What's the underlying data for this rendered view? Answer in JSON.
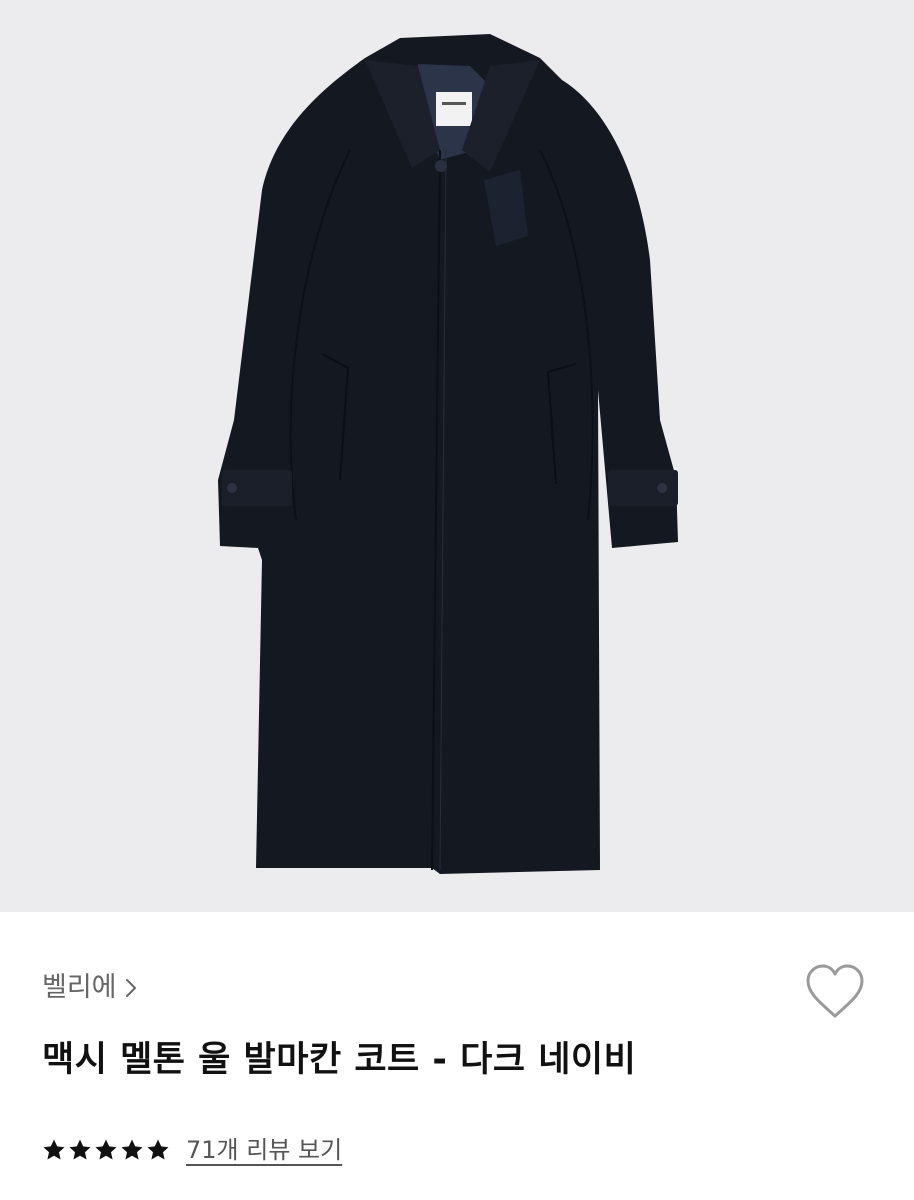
{
  "product": {
    "brand": "벨리에",
    "brand_chevron_icon": "chevron-right-icon",
    "title": "맥시 멜톤 울 발마칸 코트 - 다크 네이비",
    "wishlist_icon": "heart-outline-icon",
    "image_alt": "coat-product-image",
    "rating": {
      "stars": 5,
      "max": 5,
      "star_icon": "star-icon"
    },
    "reviews_link": "71개 리뷰 보기"
  },
  "colors": {
    "hero_background": "#ececee",
    "coat": "#141821",
    "star": "#111111",
    "heart_outline": "#9a9a9a"
  }
}
